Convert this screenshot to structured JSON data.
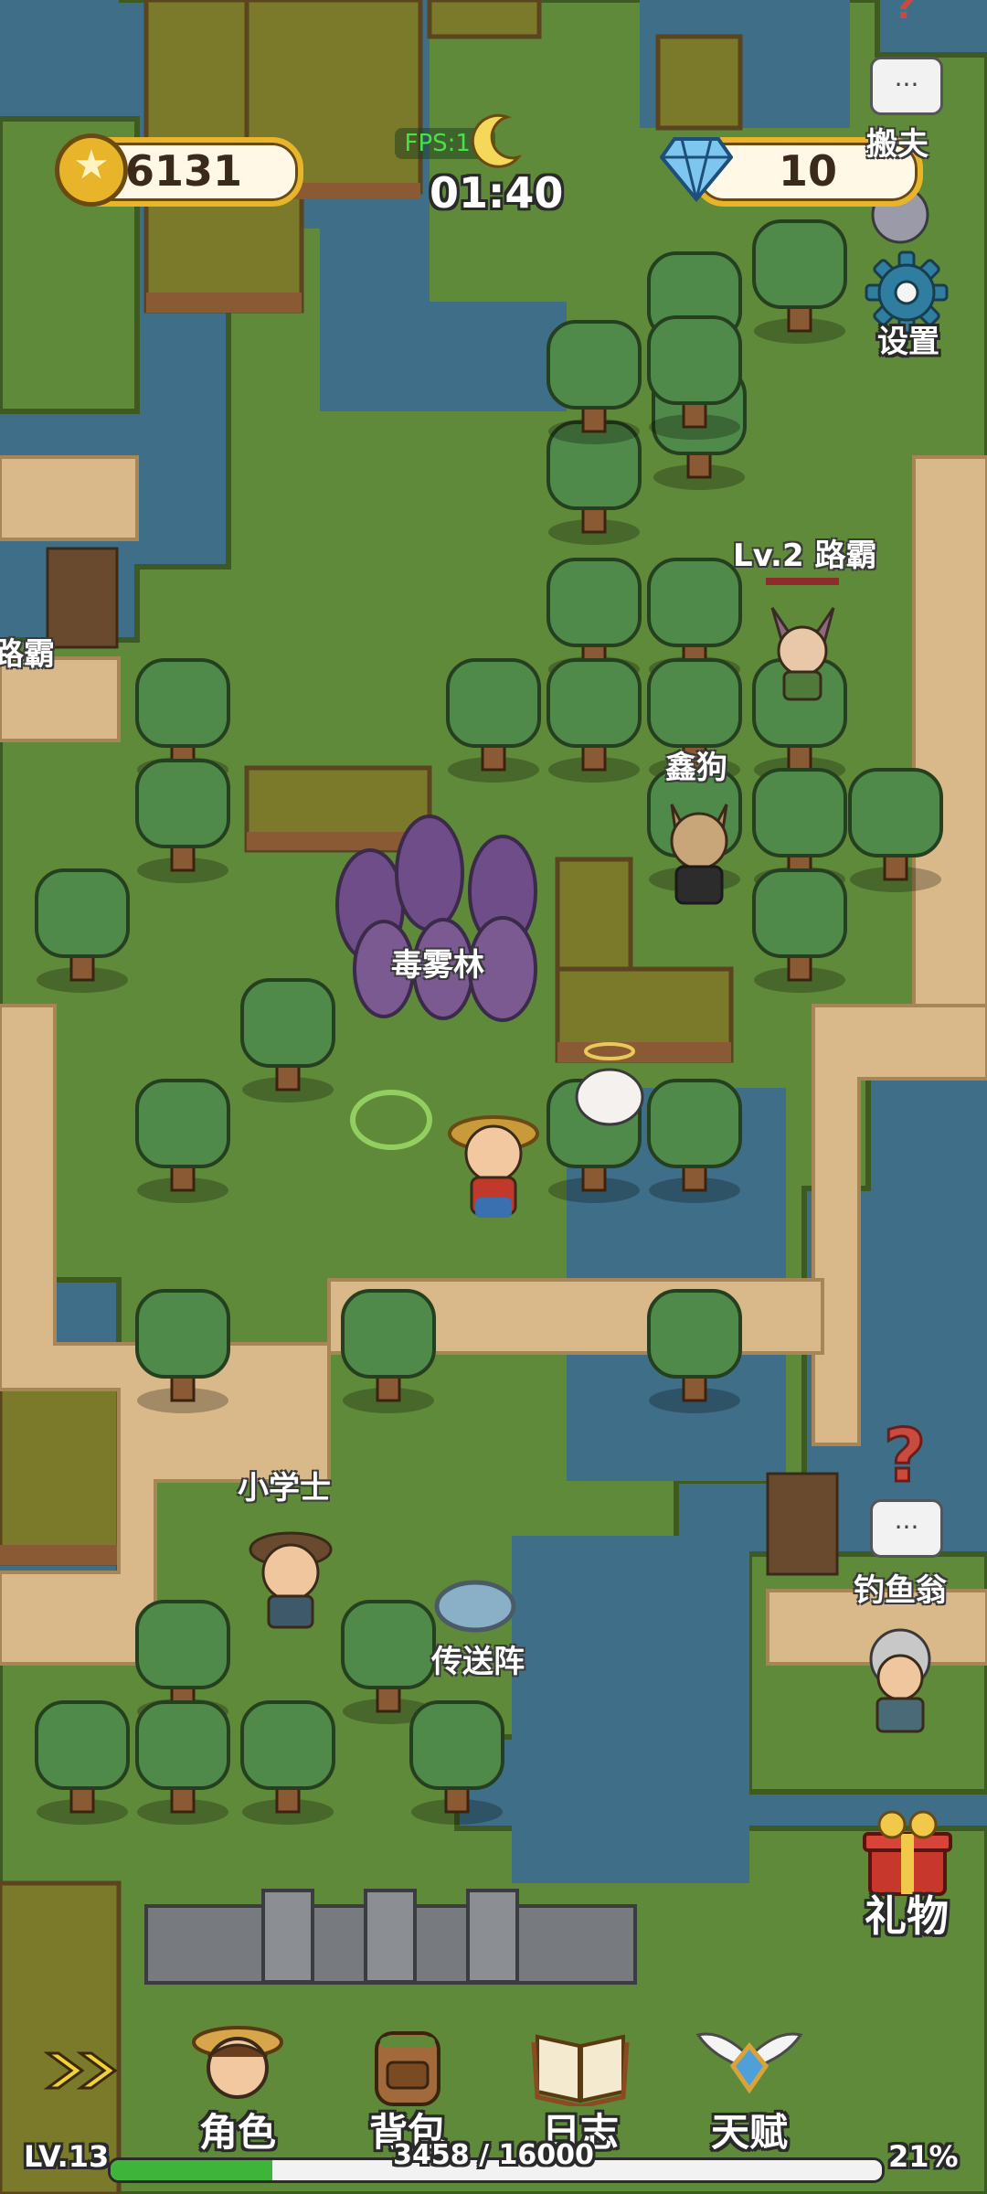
{
  "hud": {
    "coins": "6131",
    "fps": "FPS:10",
    "clock": "01:40",
    "gems": "10",
    "settings_label": "设置"
  },
  "npcs": {
    "top_right_label": "搬夫",
    "roadbully_label": "Lv.2 路霸",
    "left_roadbully_label": "路霸",
    "dog_label": "鑫狗",
    "scholar_label": "小学士",
    "fisher_label": "钓鱼翁",
    "bubble_text": "..."
  },
  "places": {
    "poison_forest": "毒雾林",
    "teleport": "传送阵"
  },
  "gift": {
    "label": "礼物"
  },
  "nav": {
    "character": "角色",
    "backpack": "背包",
    "journal": "日志",
    "talent": "天赋"
  },
  "xp": {
    "level": "LV.13",
    "progress_text": "3458 / 16000",
    "percent": "21%",
    "fraction": 0.21
  },
  "colors": {
    "water": "#3f6f88",
    "grass": "#5f8a3a",
    "sand": "#d9b98a",
    "gold": "#e8b52a",
    "xp_fill": "#3fb43a"
  }
}
